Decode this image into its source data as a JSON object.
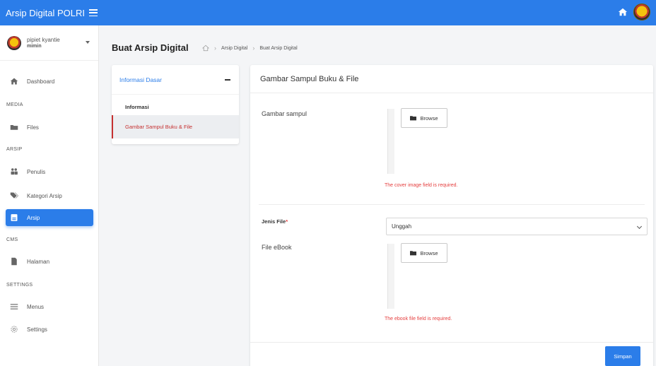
{
  "app": {
    "title": "Arsip Digital POLRI"
  },
  "user": {
    "name": "pipiet kyantie",
    "role": "mimin"
  },
  "sidebar": {
    "dashboard": "Dashboard",
    "section_media": "MEDIA",
    "files": "Files",
    "section_arsip": "ARSIP",
    "penulis": "Penulis",
    "kategori": "Kategori Arsip",
    "arsip": "Arsip",
    "section_cms": "CMS",
    "halaman": "Halaman",
    "section_settings": "SETTINGS",
    "menus": "Menus",
    "settings": "Settings"
  },
  "header": {
    "title": "Buat Arsip Digital",
    "breadcrumb": [
      "Arsip Digital",
      "Buat Arsip Digital"
    ]
  },
  "left_panel": {
    "title": "Informasi Dasar",
    "items": [
      "Informasi",
      "Gambar Sampul Buku & File"
    ]
  },
  "main_panel": {
    "title": "Gambar Sampul Buku & File",
    "cover_label": "Gambar sampul",
    "browse_label": "Browse",
    "cover_error": "The cover image field is required.",
    "jenis_label": "Jenis File",
    "required_mark": "*",
    "jenis_value": "Unggah",
    "ebook_label": "File eBook",
    "ebook_error": "The ebook file field is required.",
    "save_label": "Simpan"
  },
  "colors": {
    "primary": "#2b7de9",
    "error": "#e53e3e",
    "active_border": "#c53030"
  }
}
